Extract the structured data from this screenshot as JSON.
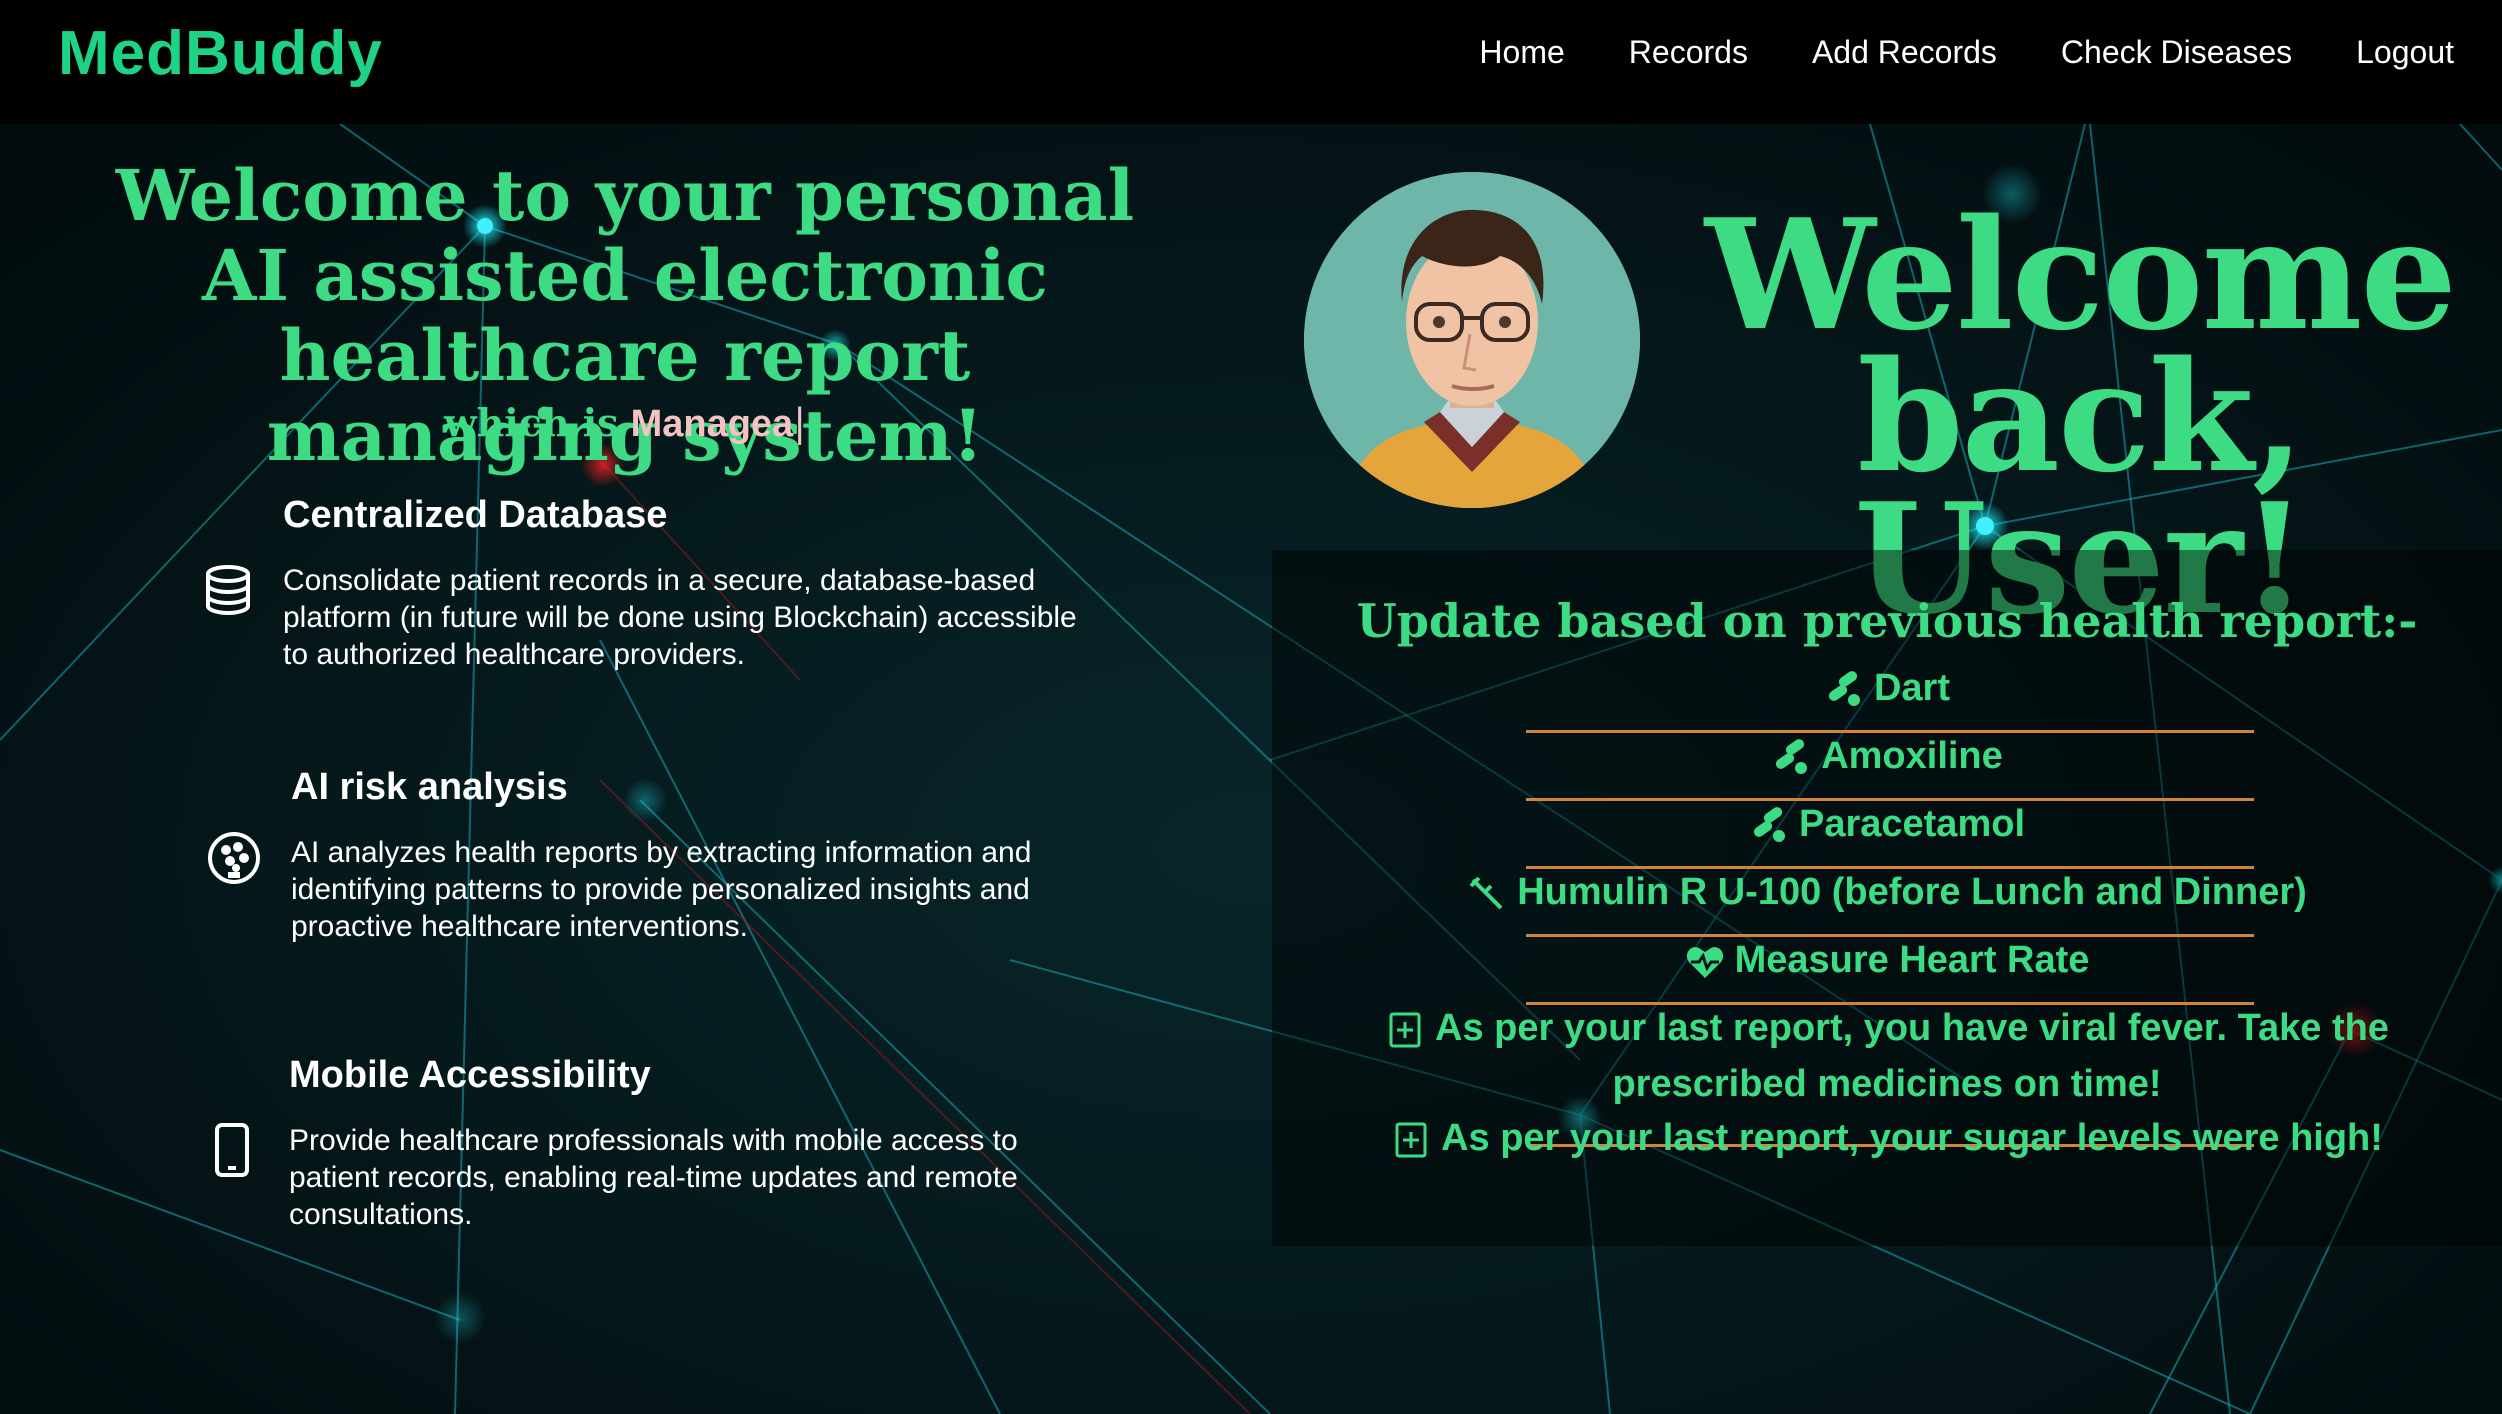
{
  "app": {
    "name": "MedBuddy"
  },
  "nav": {
    "items": [
      "Home",
      "Records",
      "Add Records",
      "Check Diseases",
      "Logout"
    ]
  },
  "hero": {
    "title": "Welcome to your personal AI assisted electronic healthcare report managing system!",
    "typing_prefix": "which is",
    "typing_text": "Managea",
    "caret": "|"
  },
  "features": [
    {
      "icon": "database-icon",
      "title": "Centralized Database",
      "text": "Consolidate patient records in a secure, database-based platform (in future will be done using Blockchain) accessible to authorized healthcare providers."
    },
    {
      "icon": "ai-brain-icon",
      "title": "AI risk analysis",
      "text": "AI analyzes health reports by extracting information and identifying patterns to provide personalized insights and proactive healthcare interventions."
    },
    {
      "icon": "mobile-phone-icon",
      "title": "Mobile Accessibility",
      "text": "Provide healthcare professionals with mobile access to patient records, enabling real-time updates and remote consultations."
    }
  ],
  "profile": {
    "greeting": "Welcome back, User!"
  },
  "updates": {
    "title": "Update based on previous health report:-",
    "items": [
      {
        "icon": "pills-icon",
        "text": "Dart"
      },
      {
        "icon": "pills-icon",
        "text": "Amoxiline"
      },
      {
        "icon": "pills-icon",
        "text": "Paracetamol"
      },
      {
        "icon": "syringe-icon",
        "text": "Humulin R U-100 (before Lunch and Dinner)"
      },
      {
        "icon": "heart-pulse-icon",
        "text": "Measure Heart Rate"
      },
      {
        "icon": "medical-notes-icon",
        "text": "As per your last report, you have viral fever. Take the prescribed medicines on time!"
      },
      {
        "icon": "medical-notes-icon",
        "text": "As per your last report, your sugar levels were high!"
      }
    ]
  },
  "colors": {
    "brand": "#1fd386",
    "accent": "#3ddc84",
    "typed": "#f4c2c2",
    "separator": "#d2843a",
    "background": "#04171a"
  }
}
